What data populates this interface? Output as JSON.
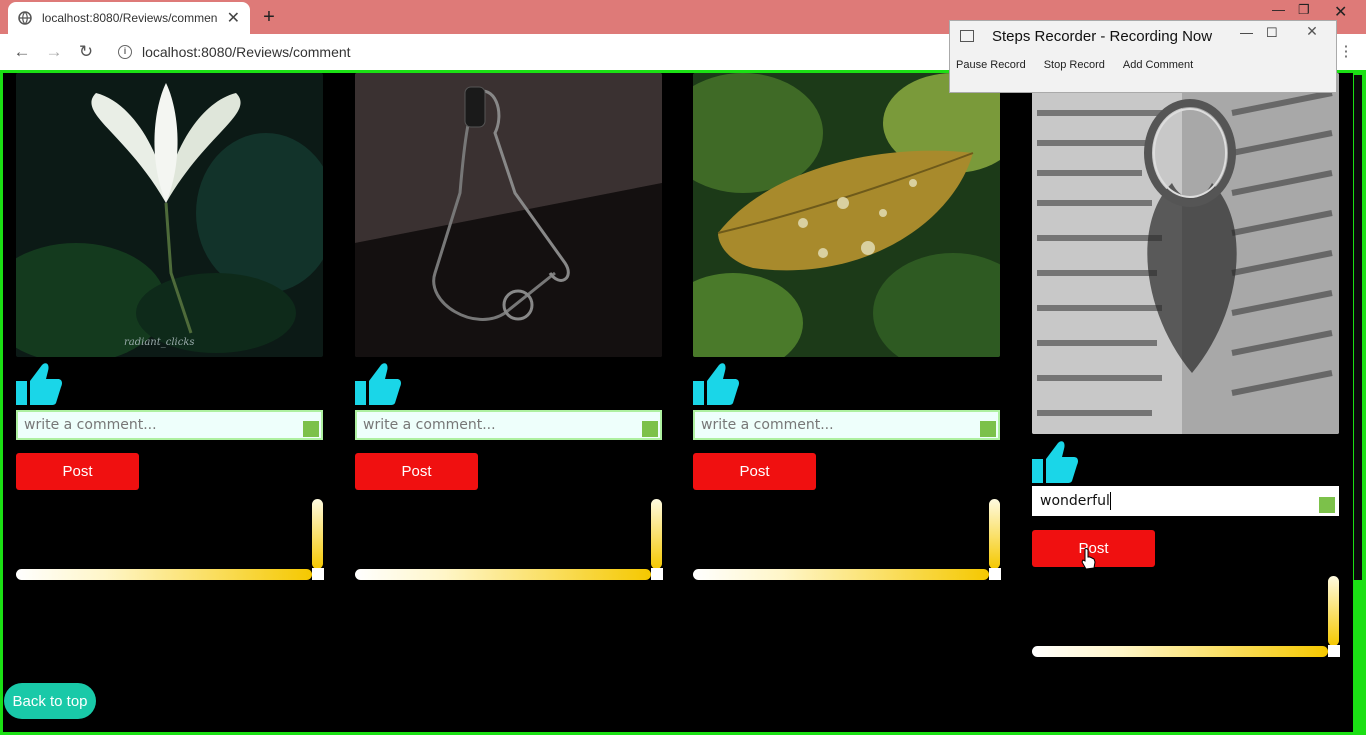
{
  "browser": {
    "tab_title": "localhost:8080/Reviews/comment",
    "url": "localhost:8080/Reviews/comment"
  },
  "recorder": {
    "title": "Steps Recorder - Recording Now",
    "tools": [
      "Pause Record",
      "Stop Record",
      "Add Comment"
    ]
  },
  "cards": [
    {
      "comment_placeholder": "write a comment...",
      "comment_value": "",
      "post_label": "Post",
      "photo_caption": "radiant_clicks"
    },
    {
      "comment_placeholder": "write a comment...",
      "comment_value": "",
      "post_label": "Post"
    },
    {
      "comment_placeholder": "write a comment...",
      "comment_value": "",
      "post_label": "Post"
    },
    {
      "comment_placeholder": "write a comment...",
      "comment_value": "wonderful",
      "post_label": "Post"
    }
  ],
  "back_to_top_label": "Back to top",
  "colors": {
    "page_border": "#1be014",
    "post_button": "#f01010",
    "like_icon": "#1ad6e8",
    "back_to_top": "#19c9a8"
  }
}
